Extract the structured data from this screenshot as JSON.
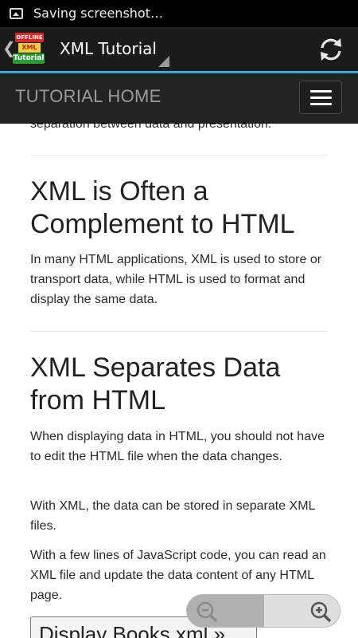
{
  "status_bar": {
    "notification_icon": "image-icon",
    "text": "Saving screenshot…"
  },
  "action_bar": {
    "back_glyph": "❮",
    "logo": {
      "line1": "OFFLINE",
      "line2": "XML",
      "line3": "Tutorial"
    },
    "title": "XML Tutorial",
    "refresh_icon": "refresh-icon"
  },
  "navbar": {
    "brand": "TUTORIAL HOME",
    "menu_icon": "hamburger-menu-icon"
  },
  "content": {
    "cut_line": "separation between data and presentation.",
    "section1": {
      "heading": "XML is Often a Complement to HTML",
      "p1": "In many HTML applications, XML is used to store or transport data, while HTML is used to format and display the same data."
    },
    "section2": {
      "heading": "XML Separates Data from HTML",
      "p1": "When displaying data in HTML, you should not have to edit the HTML file when the data changes.",
      "p2": "With XML, the data can be stored in separate XML files.",
      "p3": "With a few lines of JavaScript code, you can read an XML file and update the data content of any HTML page.",
      "button": "Display Books.xml »"
    }
  },
  "zoom_controls": {
    "zoom_out_icon": "zoom-out-icon",
    "zoom_in_icon": "zoom-in-icon"
  }
}
